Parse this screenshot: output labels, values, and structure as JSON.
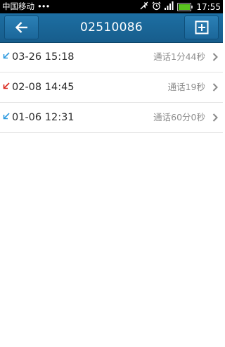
{
  "status_bar": {
    "carrier": "中国移动",
    "dots": "•••",
    "time": "17:55",
    "icons": [
      "mute-icon",
      "alarm-icon",
      "signal-icon",
      "battery-icon"
    ],
    "battery_color": "#5ac41f"
  },
  "header": {
    "title": "02510086",
    "back_icon": "back-arrow-icon",
    "add_icon": "add-contact-icon",
    "color": "#1b6699"
  },
  "calls": [
    {
      "date": "03-26 15:18",
      "duration": "通话1分44秒",
      "type": "incoming",
      "icon_color": "#2e9be0"
    },
    {
      "date": "02-08 14:45",
      "duration": "通话19秒",
      "type": "outgoing",
      "icon_color": "#d9261c"
    },
    {
      "date": "01-06 12:31",
      "duration": "通话60分0秒",
      "type": "incoming",
      "icon_color": "#2e9be0"
    }
  ]
}
